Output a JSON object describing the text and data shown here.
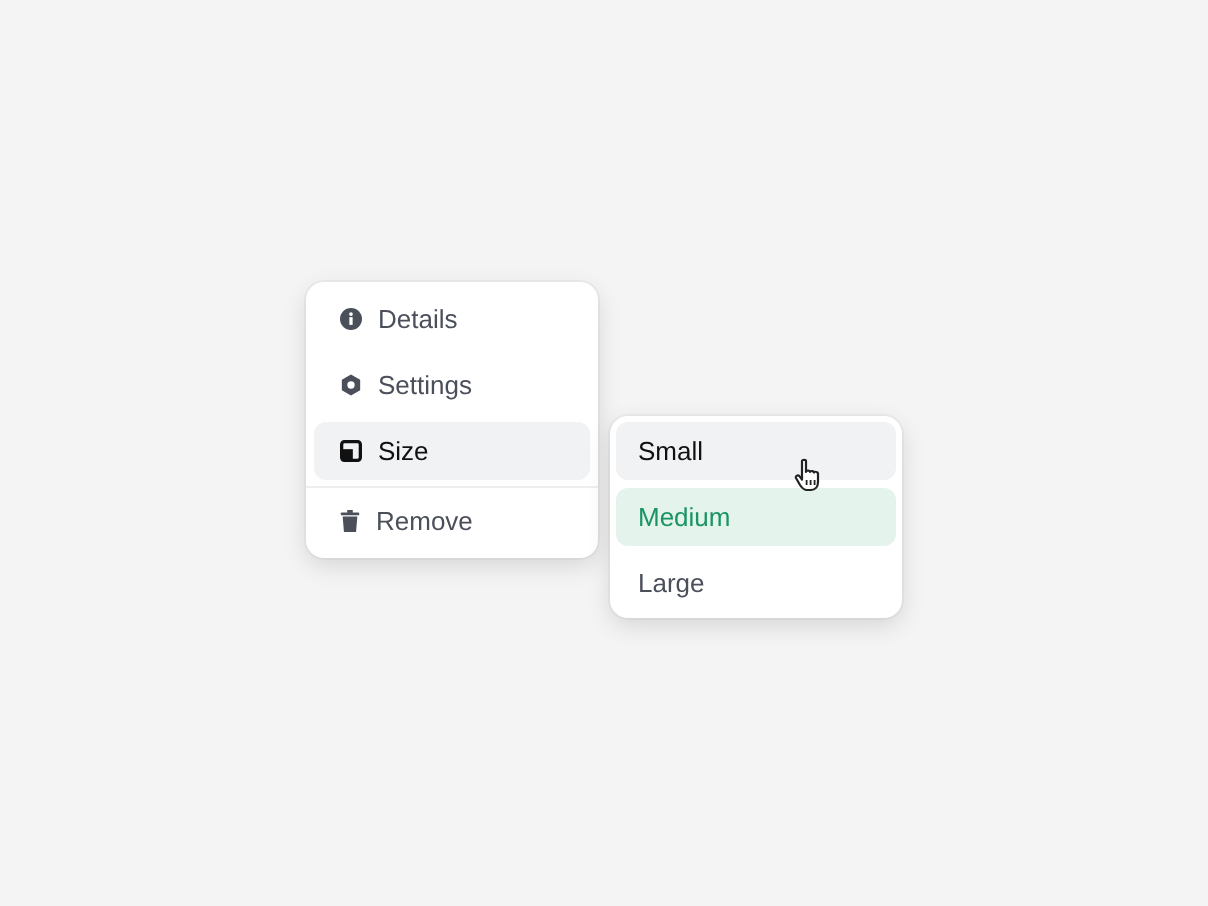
{
  "menu": {
    "items": [
      {
        "kind": "info",
        "label": "Details",
        "highlighted": false
      },
      {
        "kind": "gear",
        "label": "Settings",
        "highlighted": false
      },
      {
        "kind": "size",
        "label": "Size",
        "highlighted": true
      },
      {
        "kind": "divider"
      },
      {
        "kind": "trash",
        "label": "Remove",
        "highlighted": false
      }
    ]
  },
  "submenu": {
    "options": [
      {
        "label": "Small",
        "hovered": true,
        "selected": false
      },
      {
        "label": "Medium",
        "hovered": false,
        "selected": true
      },
      {
        "label": "Large",
        "hovered": false,
        "selected": false
      }
    ]
  }
}
